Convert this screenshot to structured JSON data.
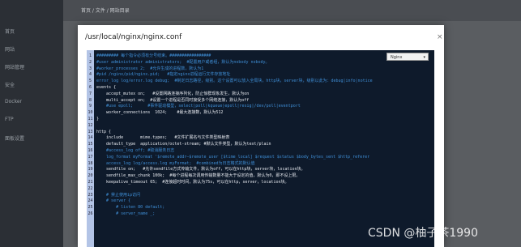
{
  "dialog": {
    "title": "/usr/local/nginx/nginx.conf",
    "close_glyph": "×",
    "mode": "Nginx",
    "mode_arrow": "▾"
  },
  "editor": {
    "lines": [
      {
        "n": "1",
        "t": "######### 每个指令必须有分号结束。#################",
        "k": "comment"
      },
      {
        "n": "2",
        "t": "#user administrator administrators;  #配置用户或者组，默认为nobody nobody。",
        "k": "comment"
      },
      {
        "n": "3",
        "t": "#worker_processes 2;  #允许生成的进程数，默认为1",
        "k": "comment"
      },
      {
        "n": "4",
        "t": "#pid /nginx/pid/nginx.pid;   #指定nginx进程运行文件存放地址",
        "k": "comment"
      },
      {
        "n": "5",
        "t": "error_log log/error.log debug;  #制定日志路径，级别。这个设置可以放入全局块，http块，server块，级别以此为：debug|info|notice",
        "k": "comment"
      },
      {
        "n": "6",
        "t": "events {",
        "k": "normal"
      },
      {
        "n": "7",
        "t": "    accept_mutex on;   #设置网路连接序列化，防止惊群现象发生，默认为on",
        "k": "normal"
      },
      {
        "n": "8",
        "t": "    multi_accept on;  #设置一个进程是否同时接受多个网络连接，默认为off",
        "k": "normal"
      },
      {
        "n": "9",
        "t": "    #use epoll;      #事件驱动模型，select|poll|kqueue|epoll|resig|/dev/poll|eventport",
        "k": "comment"
      },
      {
        "n": "10",
        "t": "    worker_connections  1024;    #最大连接数，默认为512",
        "k": "normal"
      },
      {
        "n": "11",
        "t": "}",
        "k": "normal"
      },
      {
        "n": "12",
        "t": "",
        "k": "normal"
      },
      {
        "n": "13",
        "t": "http {",
        "k": "normal"
      },
      {
        "n": "14",
        "t": "    include       mime.types;   #文件扩展名与文件类型映射表",
        "k": "normal"
      },
      {
        "n": "15",
        "t": "    default_type  application/octet-stream; #默认文件类型，默认为text/plain",
        "k": "normal"
      },
      {
        "n": "16",
        "t": "    #access_log off; #取消服务日志",
        "k": "comment"
      },
      {
        "n": "17",
        "t": "    log_format myFormat '$remote_addr–$remote_user [$time_local] $request $status $body_bytes_sent $http_referer",
        "k": "comment"
      },
      {
        "n": "18",
        "t": "    access_log log/access.log myFormat;  #combined为日志格式的默认值",
        "k": "comment"
      },
      {
        "n": "19",
        "t": "    sendfile on;   #允许sendfile方式传输文件，默认为off，可以在http块，server块，location块。",
        "k": "normal"
      },
      {
        "n": "20",
        "t": "    sendfile_max_chunk 100k;  #每个进程每次调用传输数量不能大于设定的值，默认为0，即不设上限。",
        "k": "normal"
      },
      {
        "n": "21",
        "t": "    keepalive_timeout 65;  #连接超时时间，默认为75s，可以在http，server，location块。",
        "k": "normal"
      },
      {
        "n": "22",
        "t": "",
        "k": "normal"
      },
      {
        "n": "23",
        "t": "    # 禁止使用ip访问",
        "k": "comment"
      },
      {
        "n": "24",
        "t": "    # server {",
        "k": "comment"
      },
      {
        "n": "25",
        "t": "        # listen 80 default;",
        "k": "comment"
      },
      {
        "n": "26",
        "t": "        # server_name _;",
        "k": "comment"
      }
    ]
  },
  "background": {
    "breadcrumb": "首页 / 文件 / 网站目录",
    "sidebar_items": [
      "首页",
      "网站",
      "网站管理",
      "安全",
      "Docker",
      "FTP",
      "面板设置"
    ]
  },
  "watermark": "CSDN @柚子茶1990",
  "colors": {
    "editor_bg": "#0e1a2b",
    "gutter": "#b3c4e6",
    "comment": "#3f8fd7",
    "text": "#e6e9ef"
  }
}
